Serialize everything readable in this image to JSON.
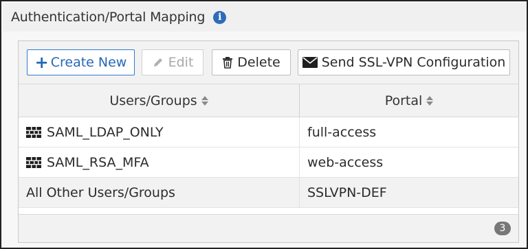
{
  "section": {
    "title": "Authentication/Portal Mapping",
    "info_icon": "info-icon"
  },
  "toolbar": {
    "create_label": "Create New",
    "edit_label": "Edit",
    "delete_label": "Delete",
    "send_label": "Send SSL-VPN Configuration"
  },
  "table": {
    "columns": [
      "Users/Groups",
      "Portal"
    ],
    "rows": [
      {
        "user": "SAML_LDAP_ONLY",
        "portal": "full-access",
        "icon": "user-group-icon"
      },
      {
        "user": "SAML_RSA_MFA",
        "portal": "web-access",
        "icon": "user-group-icon"
      },
      {
        "user": "All Other Users/Groups",
        "portal": "SSLVPN-DEF"
      }
    ]
  },
  "footer": {
    "count": "3"
  },
  "colors": {
    "accent": "#2567b6",
    "info": "#2e6cb8",
    "badge": "#777777"
  }
}
